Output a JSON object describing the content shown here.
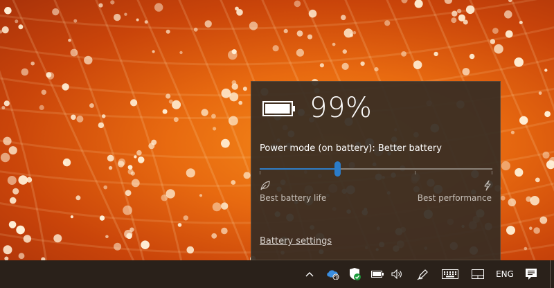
{
  "battery": {
    "percent_text": "99%",
    "charge_fraction": 0.99
  },
  "power_mode": {
    "label": "Power mode (on battery): Better battery",
    "slider_value_fraction": 0.333,
    "left_label": "Best battery life",
    "right_label": "Best performance",
    "left_icon": "leaf-icon",
    "right_icon": "lightning-icon"
  },
  "battery_settings_link": "Battery settings",
  "taskbar": {
    "tray_icons": [
      "chevron-up-icon",
      "onedrive-sync-icon",
      "windows-security-icon",
      "battery-icon",
      "volume-icon",
      "pen-icon",
      "touch-keyboard-icon",
      "touchpad-icon"
    ],
    "language": "ENG",
    "notification_icon": "action-center-icon"
  },
  "colors": {
    "accent": "#2b7cc9",
    "flyout_bg": "#362c24",
    "taskbar_bg": "#2a211a"
  }
}
